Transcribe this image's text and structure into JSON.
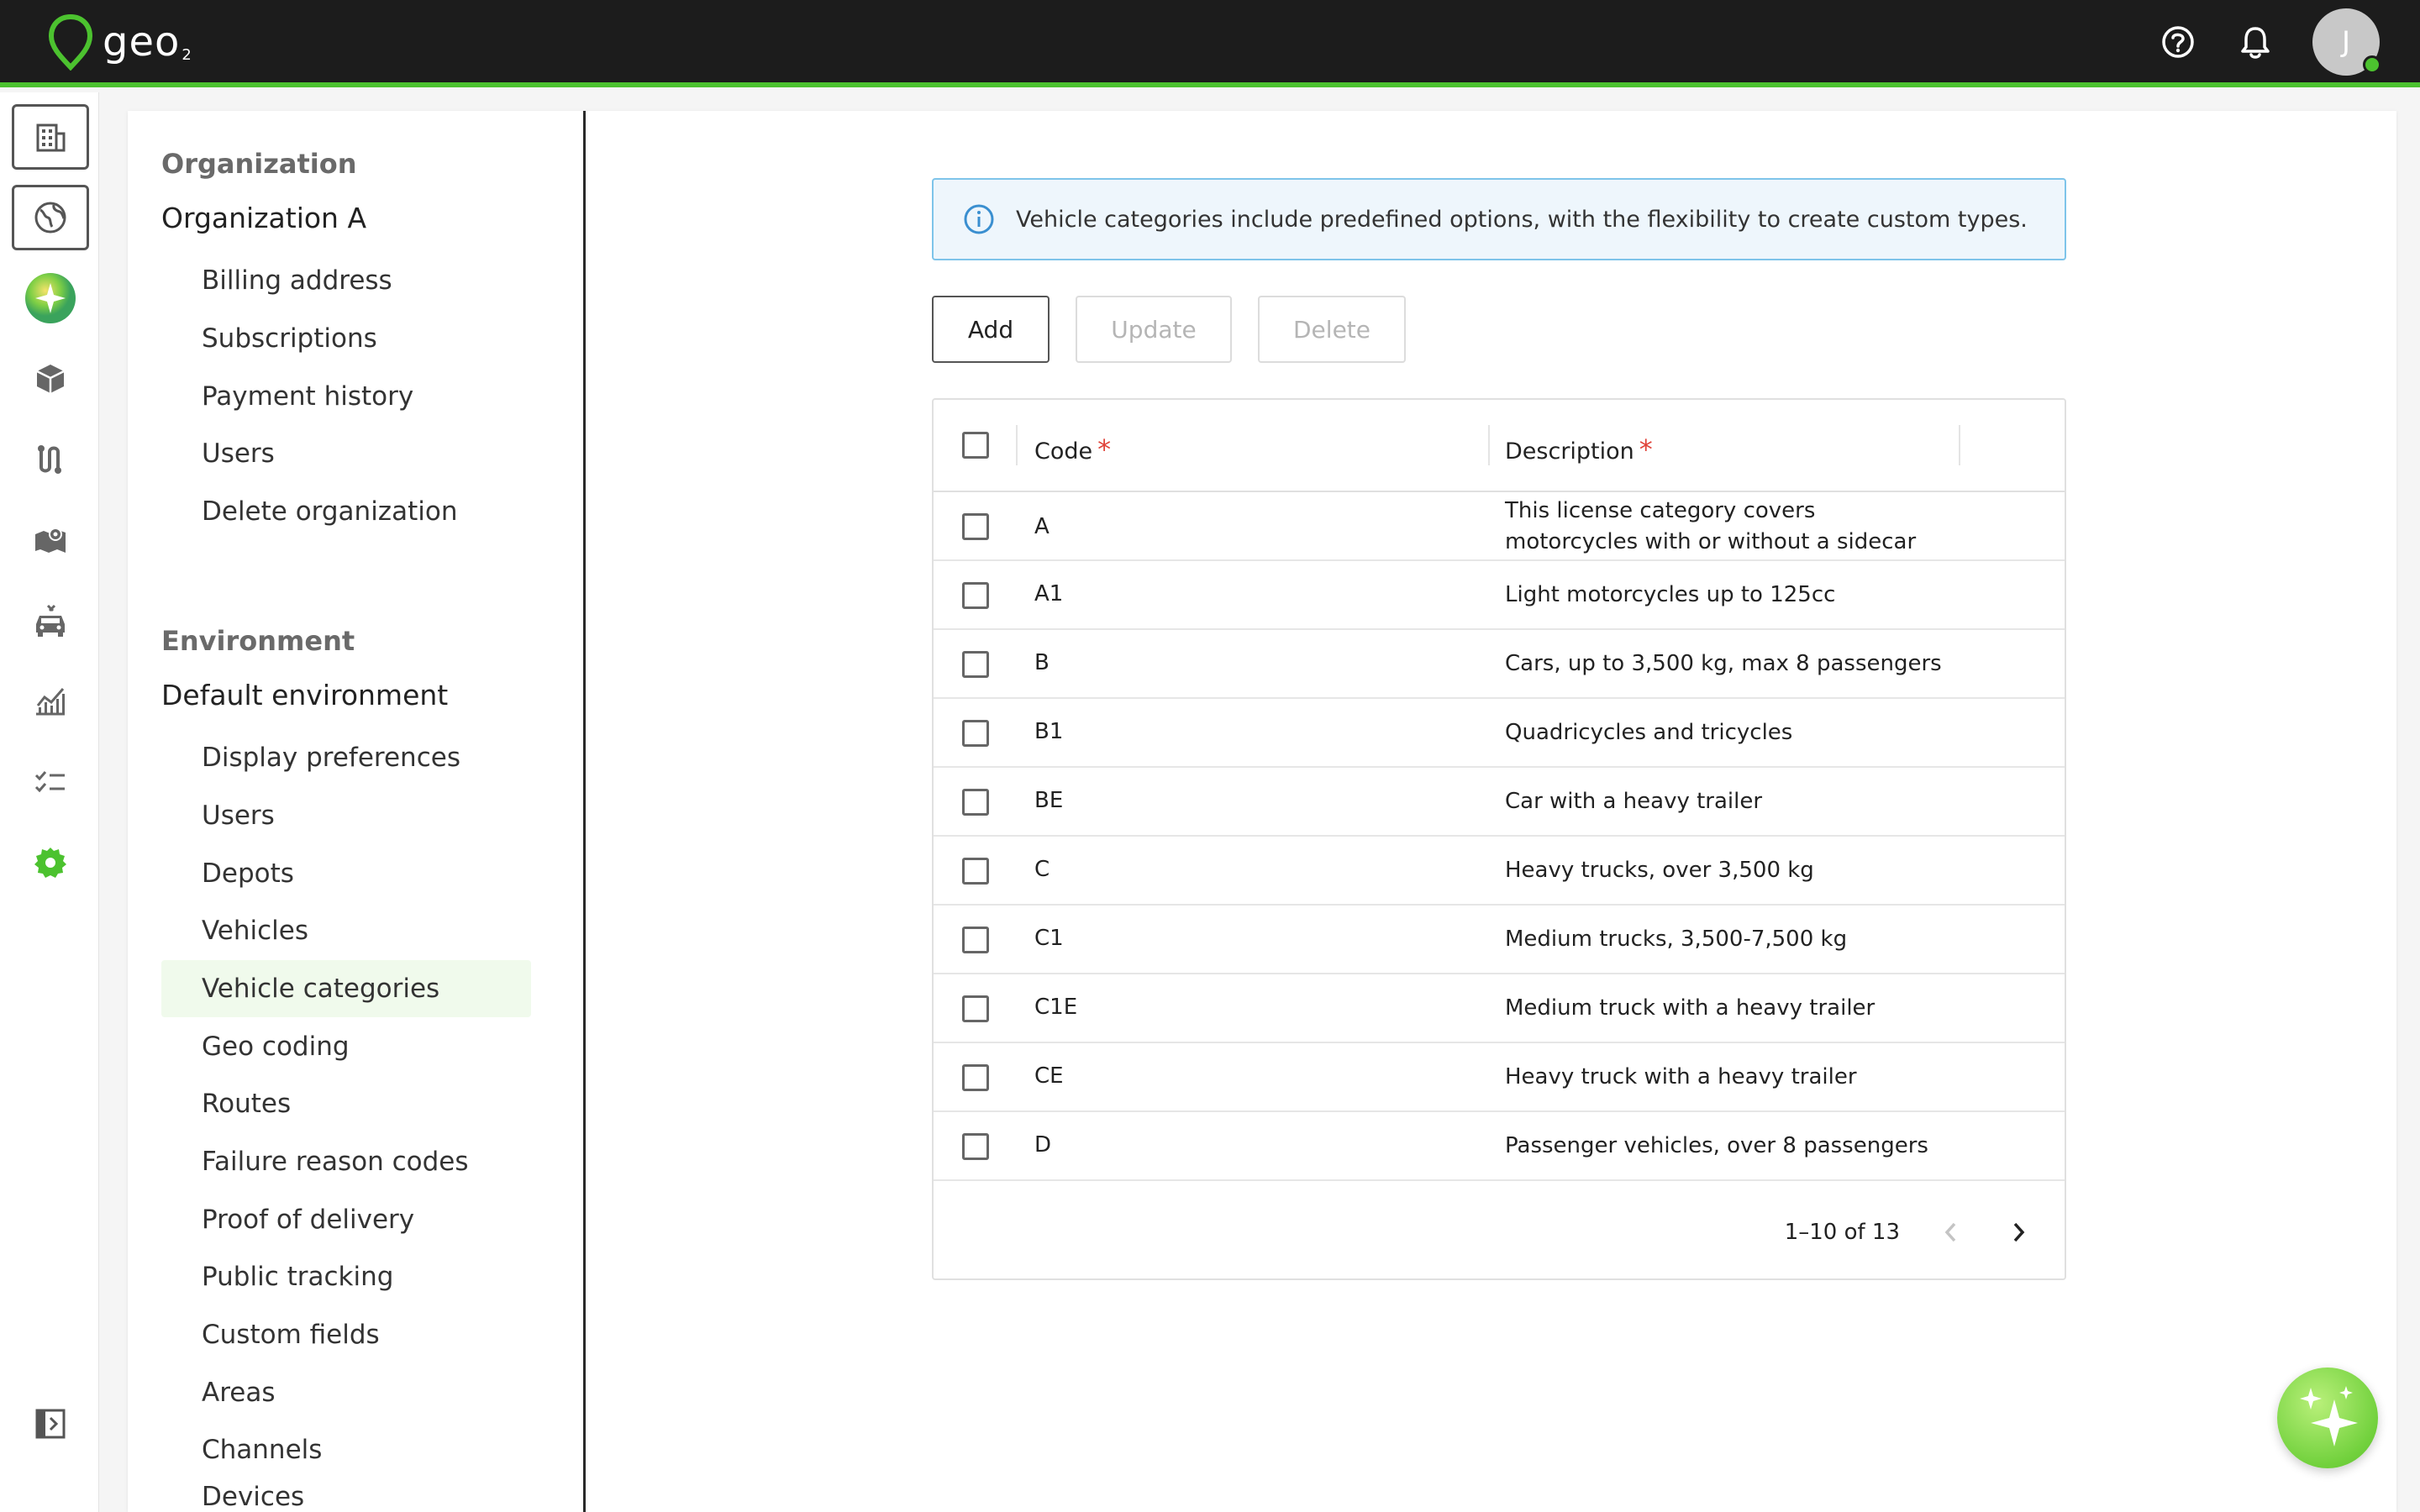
{
  "app": {
    "logo_text": "geo",
    "logo_sub": "2",
    "avatar_initial": "J"
  },
  "colors": {
    "accent": "#4cc22f",
    "topbar": "#1c1c1c",
    "info_border": "#7ec4ea",
    "required": "#e0443a"
  },
  "topbar": {
    "icons": [
      "help-icon",
      "bell-icon"
    ]
  },
  "rail": {
    "items": [
      "building-icon",
      "globe-icon",
      "ai-sparkle-icon",
      "package-icon",
      "route-icon",
      "map-icon",
      "vehicle-icon",
      "analytics-icon",
      "checklist-icon",
      "settings-icon"
    ],
    "collapse_icon": "sidebar-collapse-icon"
  },
  "nav": {
    "org_section": "Organization",
    "org_name": "Organization A",
    "org_items": [
      "Billing address",
      "Subscriptions",
      "Payment history",
      "Users",
      "Delete organization"
    ],
    "env_section": "Environment",
    "env_name": "Default environment",
    "env_items": [
      "Display preferences",
      "Users",
      "Depots",
      "Vehicles",
      "Vehicle categories",
      "Geo coding",
      "Routes",
      "Failure reason codes",
      "Proof of delivery",
      "Public tracking",
      "Custom fields",
      "Areas",
      "Channels",
      "Devices"
    ],
    "active_item": "Vehicle categories"
  },
  "info": {
    "text": "Vehicle categories include predefined options, with the flexibility to create custom types."
  },
  "toolbar": {
    "add_label": "Add",
    "update_label": "Update",
    "delete_label": "Delete"
  },
  "table": {
    "col_code": "Code",
    "col_description": "Description",
    "required_mark": "*",
    "rows": [
      {
        "code": "A",
        "description": "This license category covers motorcycles with or without a sidecar"
      },
      {
        "code": "A1",
        "description": "Light motorcycles up to 125cc"
      },
      {
        "code": "B",
        "description": "Cars, up to 3,500 kg, max 8 passengers"
      },
      {
        "code": "B1",
        "description": "Quadricycles and tricycles"
      },
      {
        "code": "BE",
        "description": "Car with a heavy trailer"
      },
      {
        "code": "C",
        "description": "Heavy trucks, over 3,500 kg"
      },
      {
        "code": "C1",
        "description": "Medium trucks, 3,500-7,500 kg"
      },
      {
        "code": "C1E",
        "description": "Medium truck with a heavy trailer"
      },
      {
        "code": "CE",
        "description": "Heavy truck with a heavy trailer"
      },
      {
        "code": "D",
        "description": "Passenger vehicles, over 8 passengers"
      }
    ],
    "pagination": "1–10 of 13"
  }
}
